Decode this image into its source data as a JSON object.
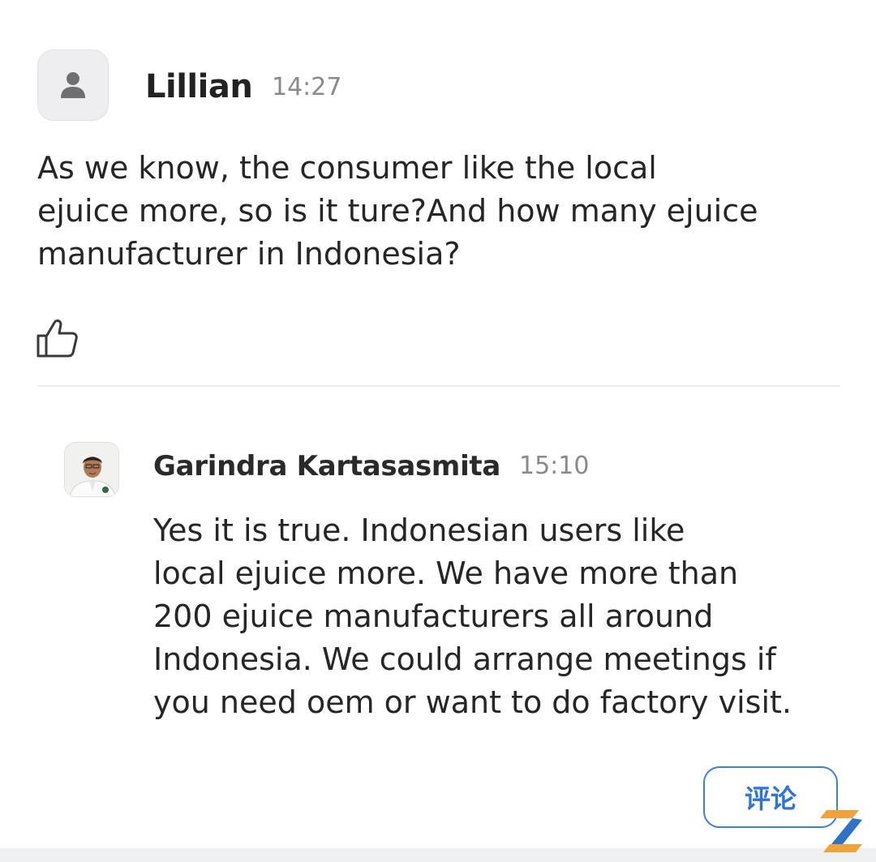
{
  "question": {
    "author": "Lillian",
    "time": "14:27",
    "avatar_icon": "user-icon",
    "lines": [
      "As we know, the consumer like the local",
      "ejuice more, so is it ture?And how many ejuice",
      "manufacturer in Indonesia?"
    ],
    "like_icon": "thumbs-up-icon"
  },
  "reply": {
    "author": "Garindra Kartasasmita",
    "time": "15:10",
    "lines": [
      "Yes it is true. Indonesian users like",
      "local ejuice more. We have more than",
      "200 ejuice manufacturers all around",
      "Indonesia. We could arrange meetings if",
      "you need oem or want to do factory visit."
    ]
  },
  "comment_button": {
    "label": "评论"
  },
  "colors": {
    "accent": "#2f74d6",
    "text": "#262626",
    "muted": "#8a8a8a",
    "divider": "#ececec"
  }
}
